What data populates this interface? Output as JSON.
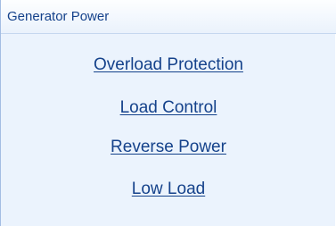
{
  "panel": {
    "title": "Generator Power",
    "links": [
      {
        "label": "Overload Protection"
      },
      {
        "label": "Load Control"
      },
      {
        "label": "Reverse Power"
      },
      {
        "label": "Low Load"
      }
    ]
  }
}
